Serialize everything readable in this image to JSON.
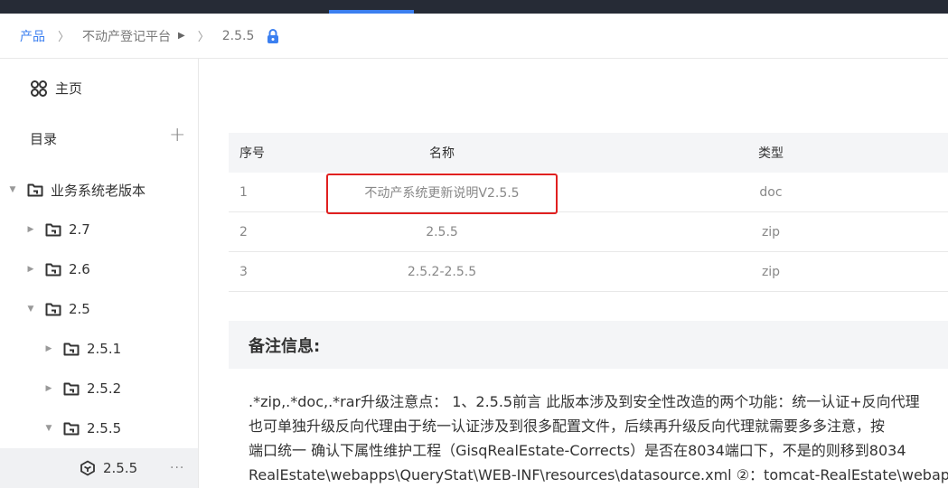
{
  "breadcrumb": {
    "product": "产品",
    "platform": "不动产登记平台",
    "version": "2.5.5"
  },
  "sidebar": {
    "home_label": "主页",
    "catalog_label": "目录",
    "tree": [
      {
        "label": "业务系统老版本",
        "expanded": true
      },
      {
        "label": "2.7",
        "expanded": false
      },
      {
        "label": "2.6",
        "expanded": false
      },
      {
        "label": "2.5",
        "expanded": true
      },
      {
        "label": "2.5.1",
        "expanded": false
      },
      {
        "label": "2.5.2",
        "expanded": false
      },
      {
        "label": "2.5.5",
        "expanded": true
      },
      {
        "label": "2.5.5",
        "selected": true
      }
    ],
    "more_label": "···"
  },
  "table": {
    "headers": {
      "index": "序号",
      "name": "名称",
      "type": "类型"
    },
    "rows": [
      {
        "index": "1",
        "name": "不动产系统更新说明V2.5.5",
        "type": "doc"
      },
      {
        "index": "2",
        "name": "2.5.5",
        "type": "zip"
      },
      {
        "index": "3",
        "name": "2.5.2-2.5.5",
        "type": "zip"
      }
    ]
  },
  "remark": {
    "title": "备注信息:",
    "lines": [
      ".*zip,.*doc,.*rar升级注意点： 1、2.5.5前言 此版本涉及到安全性改造的两个功能：统一认证+反向代理",
      "也可单独升级反向代理由于统一认证涉及到很多配置文件，后续再升级反向代理就需要多多注意，按",
      "端口统一 确认下属性维护工程（GisqRealEstate-Corrects）是否在8034端口下，不是的则移到8034",
      "RealEstate\\webapps\\QueryStat\\WEB-INF\\resources\\datasource.xml ②：tomcat-RealEstate\\webap"
    ]
  },
  "colors": {
    "accent": "#3b7ff0",
    "topbar": "#262b36",
    "highlight": "#e02020"
  }
}
